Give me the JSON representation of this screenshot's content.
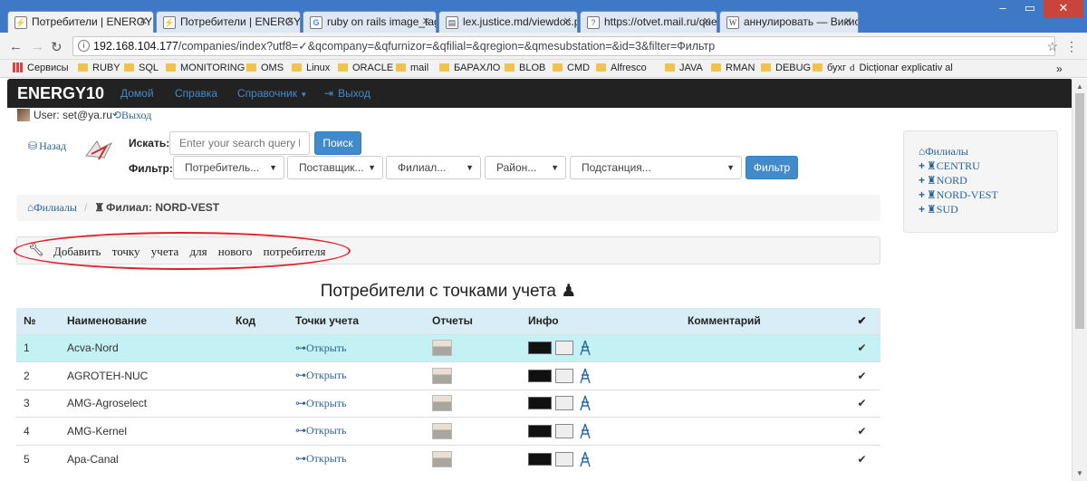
{
  "browser": {
    "tabs": [
      {
        "title": "Потребители | ENERGY1",
        "icon": "page-icon",
        "active": true
      },
      {
        "title": "Потребители | ENERGY1",
        "icon": "page-icon",
        "active": false
      },
      {
        "title": "ruby on rails image_tag",
        "icon": "google-icon",
        "active": false
      },
      {
        "title": "lex.justice.md/viewdoc.p",
        "icon": "document-icon",
        "active": false
      },
      {
        "title": "https://otvet.mail.ru/que",
        "icon": "question-icon",
        "active": false
      },
      {
        "title": "аннулировать — Викис",
        "icon": "wikipedia-icon",
        "active": false
      }
    ],
    "url_host": "192.168.104.177",
    "url_path": "/companies/index?utf8=✓&qcompany=&qfurnizor=&qfilial=&qregion=&qmesubstation=&id=3&filter=Фильтр",
    "bookmarks": [
      "Сервисы",
      "RUBY",
      "SQL",
      "MONITORING",
      "OMS",
      "Linux",
      "ORACLE",
      "mail",
      "БАРАХЛО",
      "BLOB",
      "CMD",
      "Alfresco",
      "JAVA",
      "RMAN",
      "DEBUG",
      "бухг",
      "Dicționar explicativ al"
    ],
    "more": "»"
  },
  "app": {
    "brand": "ENERGY10",
    "nav": {
      "home": "Домой",
      "help": "Справка",
      "reference": "Справочник",
      "logout": "Выход"
    },
    "user_label": "User: set@ya.ru",
    "user_logout": "Выход"
  },
  "toolbar": {
    "back": "Назад",
    "search_label": "Искать:",
    "search_placeholder": "Enter your search query he",
    "search_button": "Поиск",
    "filter_label": "Фильтр:",
    "filters": [
      "Потребитель...",
      "Поставщик...",
      "Филиал...",
      "Район...",
      "Подстанция..."
    ],
    "filter_button": "Фильтр"
  },
  "breadcrumb": {
    "root": "Филиалы",
    "current": "Филиал: NORD-VEST"
  },
  "add_link": "Добавить точку учета для нового потребителя",
  "section_title": "Потребители с точками учета",
  "table": {
    "headers": [
      "№",
      "Наименование",
      "Код",
      "Точки учета",
      "Отчеты",
      "Инфо",
      "Комментарий",
      "✔"
    ],
    "open_label": "Открыть",
    "rows": [
      {
        "num": "1",
        "name": "Acva-Nord",
        "code": "",
        "comment": "",
        "highlight": true
      },
      {
        "num": "2",
        "name": "AGROTEH-NUC",
        "code": "",
        "comment": "",
        "highlight": false
      },
      {
        "num": "3",
        "name": "AMG-Agroselect",
        "code": "",
        "comment": "",
        "highlight": false
      },
      {
        "num": "4",
        "name": "AMG-Kernel",
        "code": "",
        "comment": "",
        "highlight": false
      },
      {
        "num": "5",
        "name": "Apa-Canal",
        "code": "",
        "comment": "",
        "highlight": false
      }
    ]
  },
  "sidebar": {
    "root": "Филиалы",
    "items": [
      "CENTRU",
      "NORD",
      "NORD-VEST",
      "SUD"
    ]
  },
  "colors": {
    "primary": "#428bca",
    "navbar": "#222222",
    "highlight_row": "#c4f1f4",
    "annotation": "#e2202a"
  }
}
